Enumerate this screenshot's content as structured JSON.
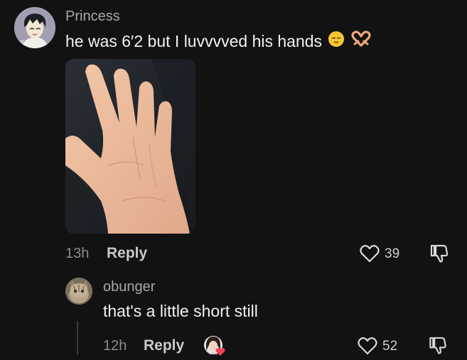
{
  "comment": {
    "username": "Princess",
    "text": "he was 6′2 but I luvvvved his hands",
    "emojis": [
      "relieved-face-emoji",
      "heart-hands-emoji"
    ],
    "timestamp": "13h",
    "reply_label": "Reply",
    "like_count": "39",
    "has_photo": true
  },
  "reply": {
    "username": "obunger",
    "text": "that's a little short still",
    "timestamp": "12h",
    "reply_label": "Reply",
    "like_count": "52",
    "liked_by_creator": true
  },
  "icons": {
    "like": "heart-outline-icon",
    "dislike": "thumbs-down-outline-icon"
  },
  "colors": {
    "background": "#121212",
    "username": "#a8a8a8",
    "text": "#f2f2f2",
    "meta": "#8c8c8c",
    "creator_heart": "#ff3b5c"
  }
}
